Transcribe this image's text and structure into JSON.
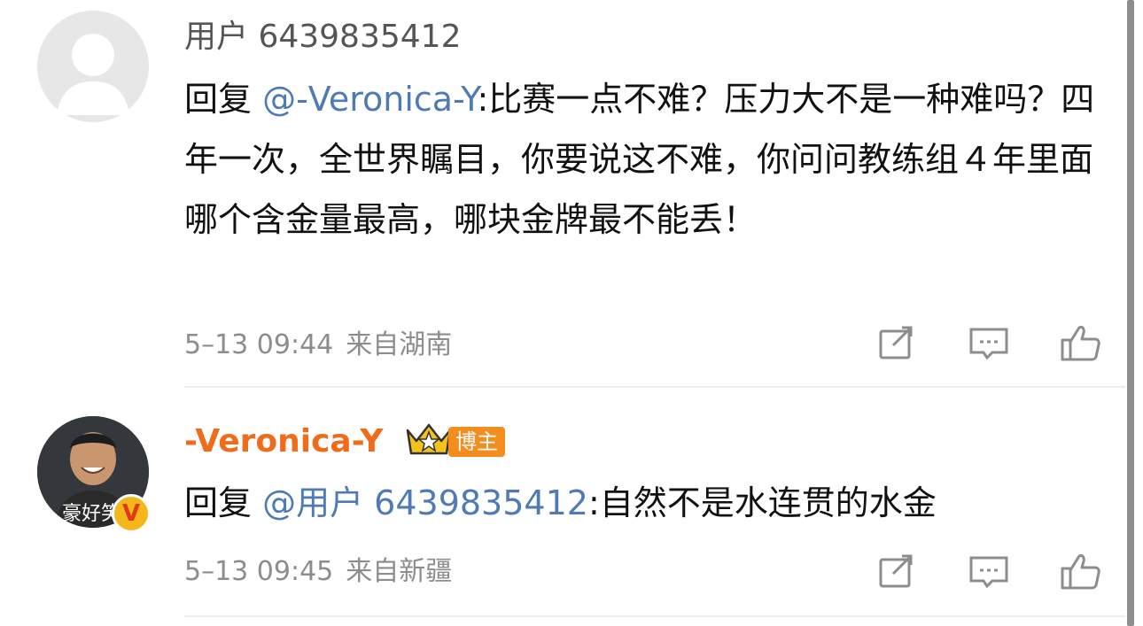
{
  "comments": [
    {
      "username": "用户 6439835412",
      "reply_prefix": "回复 ",
      "mention": "@-Veronica-Y",
      "text": ":比赛一点不难？压力大不是一种难吗？四年一次，全世界瞩目，你要说这不难，你问问教练组４年里面哪个含金量最高，哪块金牌最不能丢！",
      "time": "5–13 09:44",
      "location": "来自湖南"
    },
    {
      "username": "-Veronica-Y",
      "badge": "博主",
      "avatar_caption": "豪好笑",
      "verified_mark": "V",
      "reply_prefix": "回复 ",
      "mention": "@用户 6439835412",
      "text": ":自然不是水连贯的水金",
      "time": "5–13 09:45",
      "location": "来自新疆"
    }
  ],
  "icons": {
    "repost": "repost-icon",
    "comment": "comment-icon",
    "like": "like-icon",
    "crown": "crown-icon",
    "default_avatar": "default-avatar-icon",
    "verified": "verified-icon"
  },
  "colors": {
    "mention": "#4e7bb6",
    "author_name": "#f06b1a",
    "badge": "#f38d1e",
    "meta": "#8d8d8d"
  }
}
